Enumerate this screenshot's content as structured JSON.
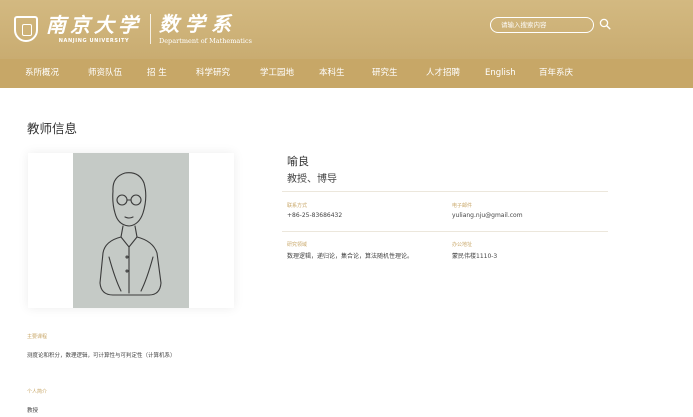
{
  "header": {
    "university_cn": "南京大学",
    "university_en": "NANJING UNIVERSITY",
    "department_cn": "数学系",
    "department_en": "Department of Mathematics",
    "search_placeholder": "请输入搜索内容",
    "brand_color": "#c9ac71"
  },
  "nav": {
    "items": [
      {
        "label": "系所概况"
      },
      {
        "label": "师资队伍"
      },
      {
        "label": "招 生"
      },
      {
        "label": "科学研究"
      },
      {
        "label": "学工园地"
      },
      {
        "label": "本科生"
      },
      {
        "label": "研究生"
      },
      {
        "label": "人才招聘"
      },
      {
        "label": "English"
      },
      {
        "label": "百年系庆"
      }
    ]
  },
  "main": {
    "page_title": "教师信息",
    "teacher": {
      "name": "喻良",
      "titles": "教授、博导"
    },
    "contact": {
      "phone_label": "联系方式",
      "phone": "+86-25-83686432",
      "email_label": "电子邮件",
      "email": "yuliang.nju@gmail.com",
      "field_label": "研究领域",
      "field": "数理逻辑，递归论，集合论，算法随机性理论。",
      "office_label": "办公地址",
      "office": "蒙民伟楼1110-3"
    },
    "courses_label": "主要课程",
    "courses": "测度论和积分，数理逻辑，可计算性与可判定性（计算机系）",
    "bio_label": "个人简介",
    "bio": "教授"
  }
}
